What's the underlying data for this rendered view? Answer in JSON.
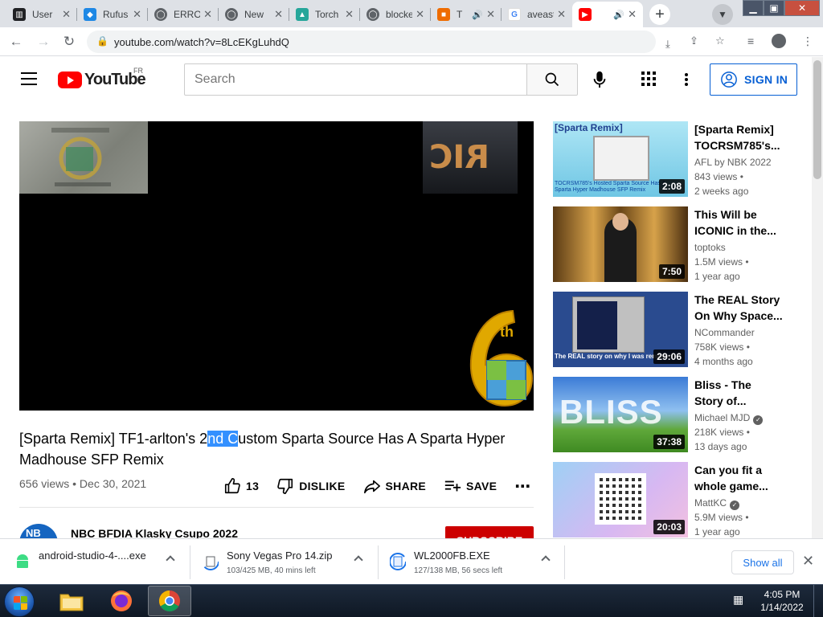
{
  "browser": {
    "tabs": [
      {
        "label": "User",
        "icon": "book-icon",
        "color": "#202124"
      },
      {
        "label": "Rufus",
        "icon": "rufus-icon",
        "color": "#1e88e5"
      },
      {
        "label": "ERROR",
        "icon": "globe-icon",
        "color": "#5f6368"
      },
      {
        "label": "New",
        "icon": "globe-icon",
        "color": "#5f6368"
      },
      {
        "label": "Torch",
        "icon": "torch-icon",
        "color": "#26a69a"
      },
      {
        "label": "blocked",
        "icon": "globe-icon",
        "color": "#5f6368"
      },
      {
        "label": "T",
        "icon": "app-icon",
        "color": "#ef6c00"
      },
      {
        "label": "aveast",
        "icon": "google-icon",
        "color": "#4285f4"
      },
      {
        "label": "",
        "icon": "youtube-icon",
        "color": "#ff0000"
      }
    ],
    "url": "youtube.com/watch?v=8LcEKgLuhdQ"
  },
  "youtube": {
    "logo_text": "YouTube",
    "region": "FR",
    "search_placeholder": "Search",
    "sign_in": "SIGN IN"
  },
  "video": {
    "title_before": "[Sparta Remix] TF1-arlton's 2",
    "title_selected": "nd C",
    "title_after": "ustom Sparta Source Has A Sparta Hyper Madhouse SFP Remix",
    "views_date": "656 views • Dec 30, 2021",
    "likes": "13",
    "dislike": "DISLIKE",
    "share": "SHARE",
    "save": "SAVE",
    "channel": "NBC BFDIA Klasky Csupo 2022",
    "subscribe": "SUBSCRIBE",
    "overlay_text": "RIC",
    "watermark_text": "th"
  },
  "related": [
    {
      "title": "[Sparta Remix] TOCRSM785's...",
      "channel": "AFL by NBK 2022",
      "verified": false,
      "views": "843 views •",
      "age": "2 weeks ago",
      "duration": "2:08"
    },
    {
      "title": "This Will be ICONIC in the...",
      "channel": "toptoks",
      "verified": false,
      "views": "1.5M views •",
      "age": "1 year ago",
      "duration": "7:50"
    },
    {
      "title": "The REAL Story On Why Space...",
      "channel": "NCommander",
      "verified": false,
      "views": "758K views •",
      "age": "4 months ago",
      "duration": "29:06"
    },
    {
      "title": "Bliss - The Story of...",
      "channel": "Michael MJD",
      "verified": true,
      "views": "218K views •",
      "age": "13 days ago",
      "duration": "37:38"
    },
    {
      "title": "Can you fit a whole game...",
      "channel": "MattKC",
      "verified": true,
      "views": "5.9M views •",
      "age": "1 year ago",
      "duration": "20:03"
    }
  ],
  "thumb_text": {
    "sparta": "[Sparta Remix]",
    "caption": "TOCRSM785's Hosted Sparta Source Has A Sparta Hyper Madhouse SFP Remix",
    "space": "The REAL story on why I was removed",
    "bliss": "BLISS"
  },
  "downloads": [
    {
      "name": "android-studio-4-....exe",
      "status": ""
    },
    {
      "name": "Sony Vegas Pro 14.zip",
      "status": "103/425 MB, 40 mins left"
    },
    {
      "name": "WL2000FB.EXE",
      "status": "127/138 MB, 56 secs left"
    }
  ],
  "show_all": "Show all",
  "taskbar": {
    "time": "4:05 PM",
    "date": "1/14/2022"
  }
}
